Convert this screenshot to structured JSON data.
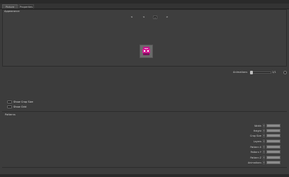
{
  "tabs": [
    {
      "label": "Picture"
    },
    {
      "label": "Properties"
    }
  ],
  "appearance": {
    "label": "Appearance",
    "nav": [
      "<",
      "<",
      "=",
      ">"
    ]
  },
  "animation": {
    "label": "Animations",
    "value": "1/1",
    "level_fraction": 0.0
  },
  "checkboxes": [
    {
      "label": "Show Crop Size"
    },
    {
      "label": "Show Grid"
    }
  ],
  "patterns": {
    "label": "Patterns",
    "fields": [
      {
        "label": "Width"
      },
      {
        "label": "Height"
      },
      {
        "label": "Crop Size"
      },
      {
        "label": "Layers"
      },
      {
        "label": "Pattern X"
      },
      {
        "label": "Pattern Y"
      },
      {
        "label": "Pattern Z"
      },
      {
        "label": "Animations"
      }
    ]
  },
  "colors": {
    "background": "#3c3c3c",
    "panel": "#3e3e3e",
    "sprite_magenta": "#c0188a",
    "field": "#8c8c8c"
  }
}
